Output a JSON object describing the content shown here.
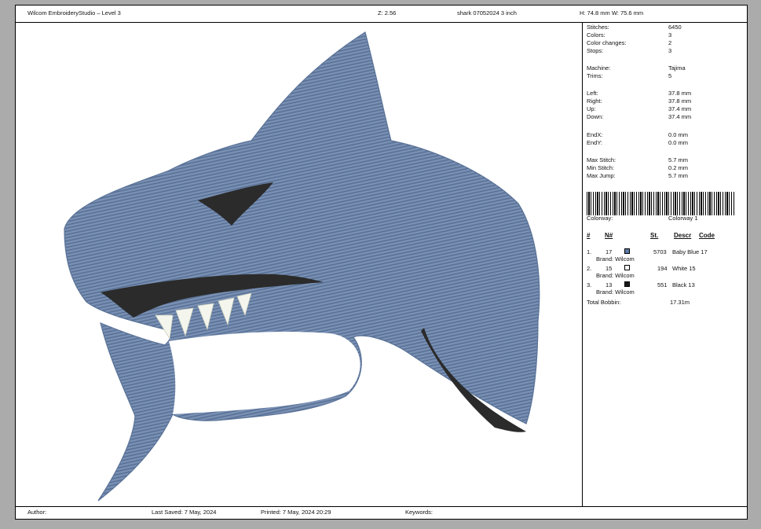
{
  "header": {
    "title": "Wilcom EmbroideryStudio – Level 3",
    "zoom": "Z: 2.56",
    "filename": "shark 07052024 3 inch",
    "dims": "H: 74.8 mm   W: 75.6 mm"
  },
  "stats": [
    {
      "label": "Stitches:",
      "value": "6450"
    },
    {
      "label": "Colors:",
      "value": "3"
    },
    {
      "label": "Color changes:",
      "value": "2"
    },
    {
      "label": "Stops:",
      "value": "3"
    },
    {
      "label": "Machine:",
      "value": "Tajima"
    },
    {
      "label": "Trims:",
      "value": "5"
    },
    {
      "label": "Left:",
      "value": "37.8 mm"
    },
    {
      "label": "Right:",
      "value": "37.8 mm"
    },
    {
      "label": "Up:",
      "value": "37.4 mm"
    },
    {
      "label": "Down:",
      "value": "37.4 mm"
    },
    {
      "label": "EndX:",
      "value": "0.0 mm"
    },
    {
      "label": "EndY:",
      "value": "0.0 mm"
    },
    {
      "label": "Max Stitch:",
      "value": "5.7 mm"
    },
    {
      "label": "Min Stitch:",
      "value": "0.2 mm"
    },
    {
      "label": "Max Jump:",
      "value": "5.7 mm"
    }
  ],
  "colorway": {
    "label": "Colorway:",
    "value": "Colorway 1"
  },
  "table": {
    "headers": {
      "num": "#",
      "n": "N#",
      "st": "St.",
      "descr": "Descr",
      "code": "Code"
    },
    "rows": [
      {
        "num": "1.",
        "n": "17",
        "color": "#5b7aa5",
        "st": "5703",
        "descr": "Baby Blue 17",
        "brand": "Brand: Wilcom"
      },
      {
        "num": "2.",
        "n": "15",
        "color": "#ffffff",
        "st": "194",
        "descr": "White 15",
        "brand": "Brand: Wilcom"
      },
      {
        "num": "3.",
        "n": "13",
        "color": "#1a1a1a",
        "st": "551",
        "descr": "Black 13",
        "brand": "Brand: Wilcom"
      }
    ],
    "bobbin_label": "Total Bobbin:",
    "bobbin_value": "17.31m"
  },
  "footer": {
    "author": "Author:",
    "last_saved": "Last Saved:  7 May, 2024",
    "printed": "Printed:  7 May, 2024 20:29",
    "keywords": "Keywords:"
  },
  "colors": {
    "shark_blue": "#6e86aa",
    "shark_blue_dark": "#5a7297",
    "black_thread": "#2b2b2b",
    "white_thread": "#f4f6ee"
  }
}
